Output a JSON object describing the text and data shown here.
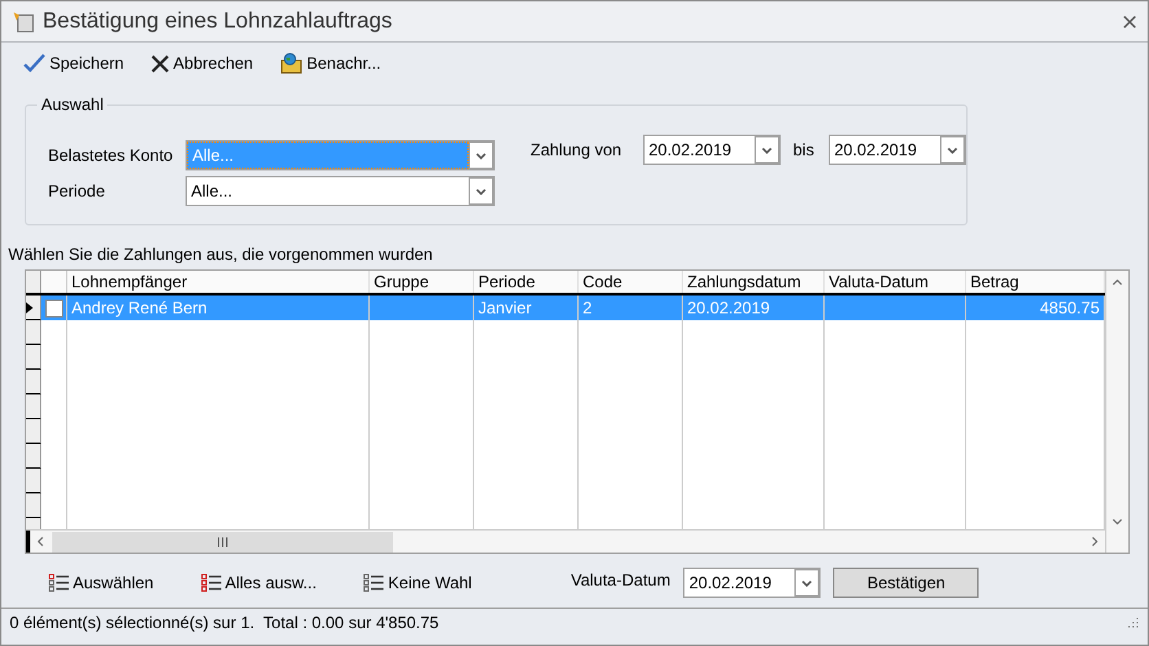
{
  "window": {
    "title": "Bestätigung eines Lohnzahlauftrags"
  },
  "toolbar": [
    {
      "kind": "check",
      "label": "Speichern"
    },
    {
      "kind": "cross",
      "label": "Abbrechen"
    },
    {
      "kind": "notify",
      "label": "Benachr..."
    }
  ],
  "auswahl": {
    "title": "Auswahl",
    "konto": {
      "label": "Belastetes Konto",
      "value": "Alle..."
    },
    "periode": {
      "label": "Periode",
      "value": "Alle..."
    },
    "von": {
      "label": "Zahlung von",
      "value": "20.02.2019"
    },
    "bis": {
      "label": "bis",
      "value": "20.02.2019"
    }
  },
  "instruction": "Wählen Sie die Zahlungen aus, die vorgenommen wurden",
  "table": {
    "columns": [
      "Lohnempfänger",
      "Gruppe",
      "Periode",
      "Code",
      "Zahlungsdatum",
      "Valuta-Datum",
      "Betrag"
    ],
    "rows": [
      {
        "selected": true,
        "checked": false,
        "cells": [
          "Andrey René Bern",
          "",
          "Janvier",
          "2",
          "20.02.2019",
          "",
          "4850.75"
        ]
      }
    ]
  },
  "actions": [
    {
      "kind": "select",
      "label": "Auswählen"
    },
    {
      "kind": "all",
      "label": "Alles ausw..."
    },
    {
      "kind": "none",
      "label": "Keine Wahl"
    }
  ],
  "valuta": {
    "label": "Valuta-Datum",
    "value": "20.02.2019"
  },
  "confirm": "Bestätigen",
  "status_bar": "0 élément(s) sélectionné(s) sur 1.  Total : 0.00 sur 4'850.75"
}
